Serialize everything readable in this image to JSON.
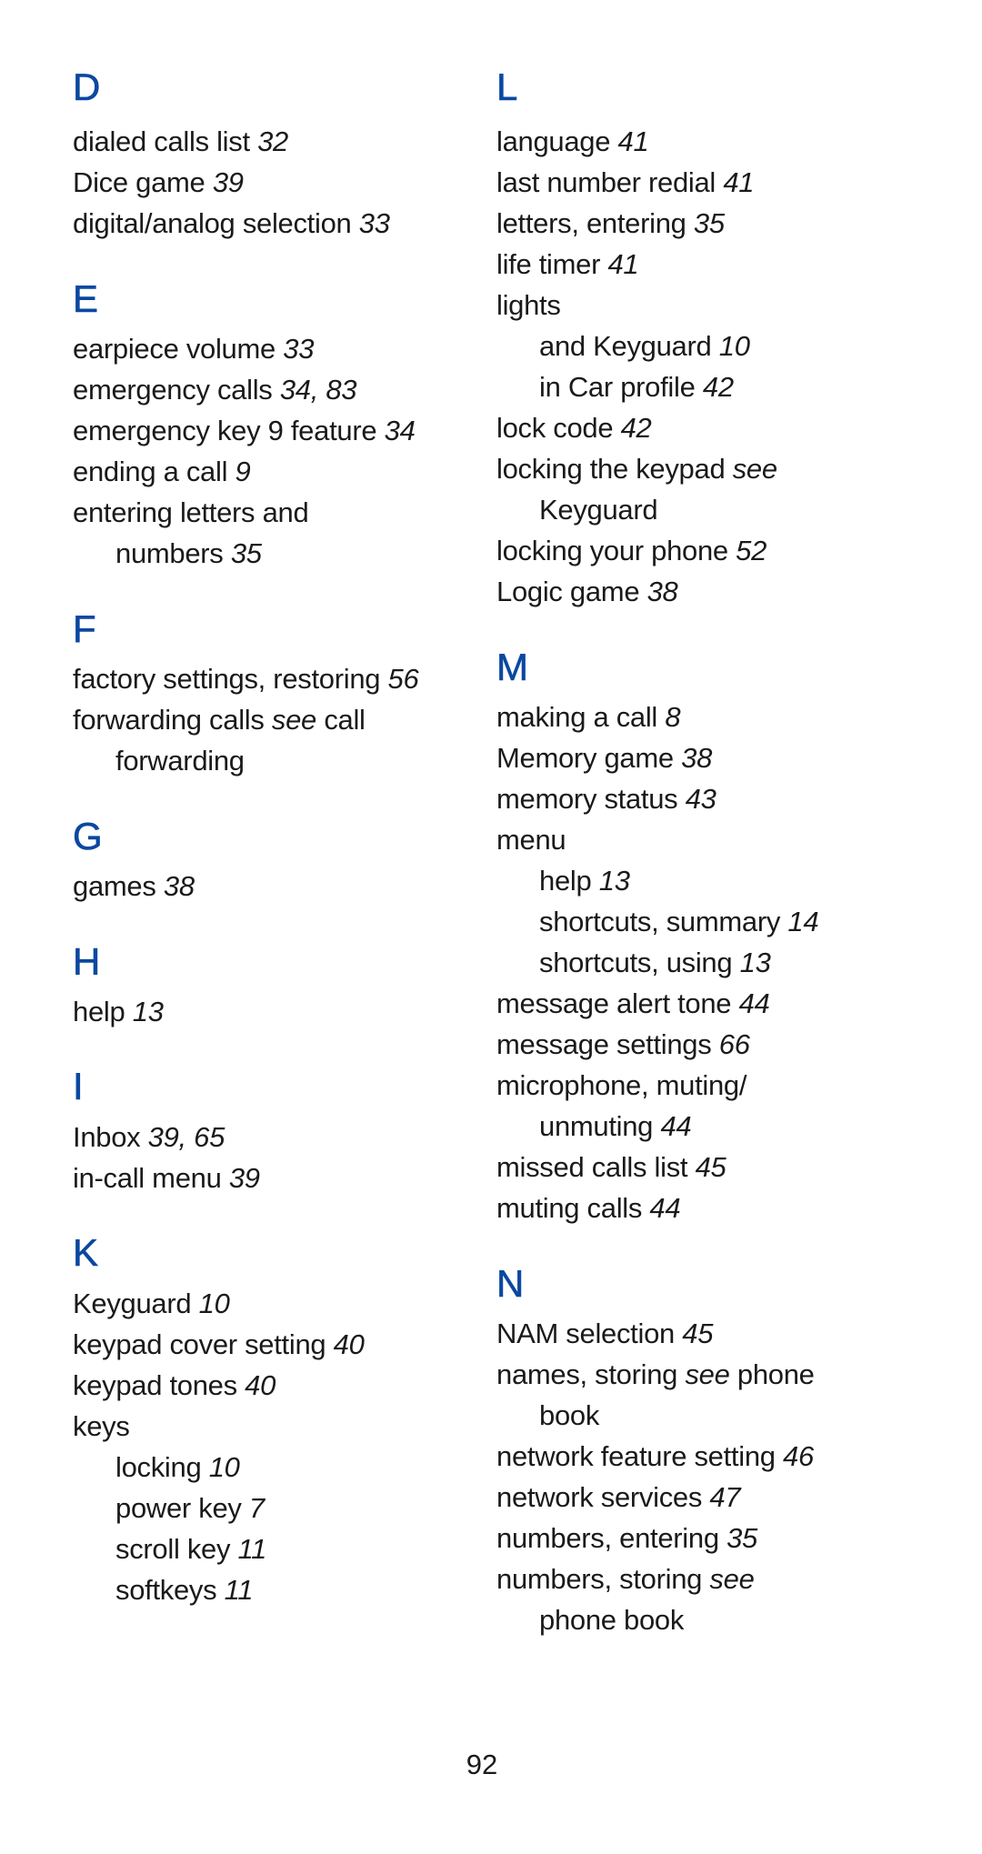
{
  "page_number": "92",
  "heading_color": "#0a48a0",
  "columns": [
    {
      "sections": [
        {
          "letter": "D",
          "entries": [
            {
              "text": "dialed calls list",
              "pages": "32",
              "sub": false
            },
            {
              "text": "Dice game",
              "pages": "39",
              "sub": false
            },
            {
              "text": "digital/analog selection",
              "pages": "33",
              "sub": false
            }
          ]
        },
        {
          "letter": "E",
          "entries": [
            {
              "text": "earpiece volume",
              "pages": "33",
              "sub": false
            },
            {
              "text": "emergency calls",
              "pages": "34, 83",
              "sub": false
            },
            {
              "text": "emergency key 9 feature",
              "pages": "34",
              "sub": false
            },
            {
              "text": "ending a call",
              "pages": "9",
              "sub": false
            },
            {
              "text": "entering letters and",
              "pages": "",
              "sub": false
            },
            {
              "text": "numbers",
              "pages": "35",
              "sub": true
            }
          ]
        },
        {
          "letter": "F",
          "entries": [
            {
              "text": "factory settings, restoring",
              "pages": "56",
              "sub": false
            },
            {
              "text": "forwarding calls",
              "see": "see",
              "after": "call",
              "pages": "",
              "sub": false
            },
            {
              "text": "forwarding",
              "pages": "",
              "sub": true
            }
          ]
        },
        {
          "letter": "G",
          "entries": [
            {
              "text": "games",
              "pages": "38",
              "sub": false
            }
          ]
        },
        {
          "letter": "H",
          "entries": [
            {
              "text": "help",
              "pages": "13",
              "sub": false
            }
          ]
        },
        {
          "letter": "I",
          "entries": [
            {
              "text": "Inbox",
              "pages": "39, 65",
              "sub": false
            },
            {
              "text": "in-call menu",
              "pages": "39",
              "sub": false
            }
          ]
        },
        {
          "letter": "K",
          "entries": [
            {
              "text": "Keyguard",
              "pages": "10",
              "sub": false
            },
            {
              "text": "keypad cover setting",
              "pages": "40",
              "sub": false
            },
            {
              "text": "keypad tones",
              "pages": "40",
              "sub": false
            },
            {
              "text": "keys",
              "pages": "",
              "sub": false
            },
            {
              "text": "locking",
              "pages": "10",
              "sub": true
            },
            {
              "text": "power key",
              "pages": "7",
              "sub": true
            },
            {
              "text": "scroll key",
              "pages": "11",
              "sub": true
            },
            {
              "text": "softkeys",
              "pages": "11",
              "sub": true
            }
          ]
        }
      ]
    },
    {
      "sections": [
        {
          "letter": "L",
          "entries": [
            {
              "text": "language",
              "pages": "41",
              "sub": false
            },
            {
              "text": "last number redial",
              "pages": "41",
              "sub": false
            },
            {
              "text": "letters, entering",
              "pages": "35",
              "sub": false
            },
            {
              "text": "life timer",
              "pages": "41",
              "sub": false
            },
            {
              "text": "lights",
              "pages": "",
              "sub": false
            },
            {
              "text": "and Keyguard",
              "pages": "10",
              "sub": true
            },
            {
              "text": "in Car profile",
              "pages": "42",
              "sub": true
            },
            {
              "text": "lock code",
              "pages": "42",
              "sub": false
            },
            {
              "text": "locking the keypad",
              "see": "see",
              "pages": "",
              "sub": false
            },
            {
              "text": "Keyguard",
              "pages": "",
              "sub": true
            },
            {
              "text": "locking your phone",
              "pages": "52",
              "sub": false
            },
            {
              "text": "Logic game",
              "pages": "38",
              "sub": false
            }
          ]
        },
        {
          "letter": "M",
          "entries": [
            {
              "text": "making a call",
              "pages": "8",
              "sub": false
            },
            {
              "text": "Memory game",
              "pages": "38",
              "sub": false
            },
            {
              "text": "memory status",
              "pages": "43",
              "sub": false
            },
            {
              "text": "menu",
              "pages": "",
              "sub": false
            },
            {
              "text": "help",
              "pages": "13",
              "sub": true
            },
            {
              "text": "shortcuts, summary",
              "pages": "14",
              "sub": true
            },
            {
              "text": "shortcuts, using",
              "pages": "13",
              "sub": true
            },
            {
              "text": "message alert tone",
              "pages": "44",
              "sub": false
            },
            {
              "text": "message settings",
              "pages": "66",
              "sub": false
            },
            {
              "text": "microphone, muting/",
              "pages": "",
              "sub": false
            },
            {
              "text": "unmuting",
              "pages": "44",
              "sub": true
            },
            {
              "text": "missed calls list",
              "pages": "45",
              "sub": false
            },
            {
              "text": "muting calls",
              "pages": "44",
              "sub": false
            }
          ]
        },
        {
          "letter": "N",
          "entries": [
            {
              "text": "NAM selection",
              "pages": "45",
              "sub": false
            },
            {
              "text": "names, storing",
              "see": "see",
              "after": "phone",
              "pages": "",
              "sub": false
            },
            {
              "text": "book",
              "pages": "",
              "sub": true
            },
            {
              "text": "network feature setting",
              "pages": "46",
              "sub": false
            },
            {
              "text": "network services",
              "pages": "47",
              "sub": false
            },
            {
              "text": "numbers, entering",
              "pages": "35",
              "sub": false
            },
            {
              "text": "numbers, storing",
              "see": "see",
              "pages": "",
              "sub": false
            },
            {
              "text": "phone book",
              "pages": "",
              "sub": true
            }
          ]
        }
      ]
    }
  ]
}
